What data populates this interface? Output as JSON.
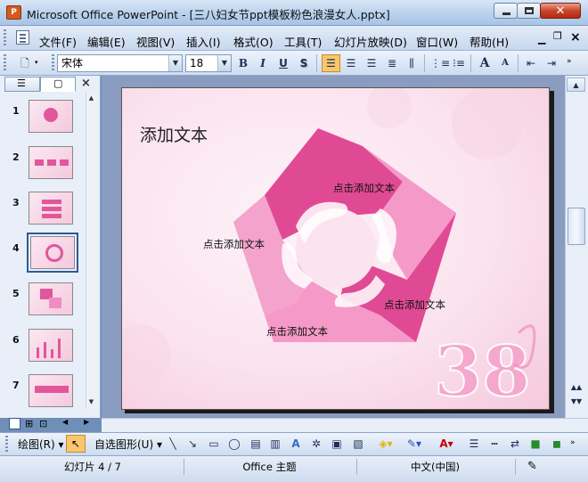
{
  "window": {
    "title": "Microsoft Office PowerPoint - [三八妇女节ppt模板粉色浪漫女人.pptx]",
    "app_icon_label": "P"
  },
  "menu": {
    "items": [
      {
        "label": "文件(F)"
      },
      {
        "label": "编辑(E)"
      },
      {
        "label": "视图(V)"
      },
      {
        "label": "插入(I)"
      },
      {
        "label": "格式(O)"
      },
      {
        "label": "工具(T)"
      },
      {
        "label": "幻灯片放映(D)"
      },
      {
        "label": "窗口(W)"
      },
      {
        "label": "帮助(H)"
      }
    ],
    "doc_close": "×"
  },
  "toolbar": {
    "font_name": "宋体",
    "font_size": "18",
    "bold": "B",
    "italic": "I",
    "underline": "U",
    "shadow": "S",
    "grow_font": "A",
    "shrink_font": "A"
  },
  "side_panel": {
    "close": "×",
    "slides": [
      {
        "number": "1"
      },
      {
        "number": "2"
      },
      {
        "number": "3"
      },
      {
        "number": "4",
        "selected": true
      },
      {
        "number": "5"
      },
      {
        "number": "6"
      },
      {
        "number": "7"
      }
    ]
  },
  "slide": {
    "title": "添加文本",
    "placeholders": [
      "点击添加文本",
      "点击添加文本",
      "点击添加文本",
      "点击添加文本"
    ],
    "colors": {
      "dark_pink": "#e04a95",
      "light_pink": "#f59ac8",
      "background": "#fbe3ef"
    },
    "logo_text": "38"
  },
  "drawing_toolbar": {
    "draw_label": "绘图(R)",
    "autoshapes_label": "自选图形(U)"
  },
  "status": {
    "slide_info": "幻灯片 4 / 7",
    "theme": "Office 主题",
    "language": "中文(中国)"
  }
}
